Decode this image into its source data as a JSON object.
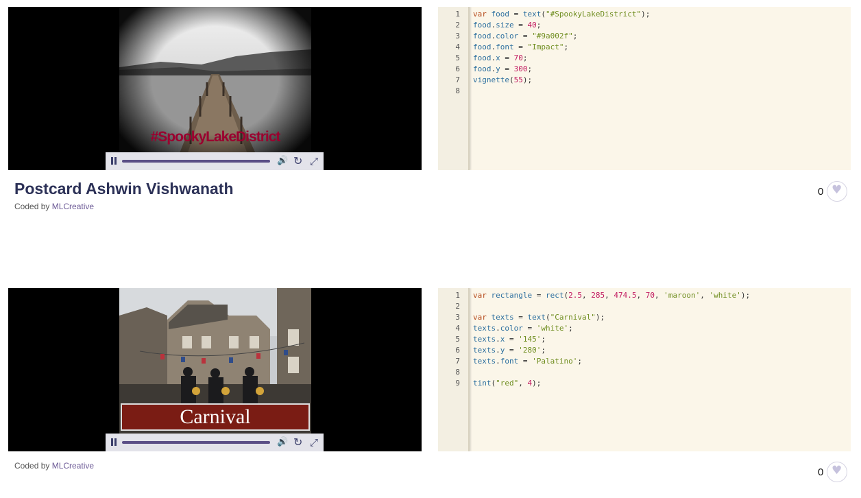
{
  "entries": [
    {
      "title": "Postcard Ashwin Vishwanath",
      "coded_by_prefix": "Coded by ",
      "author": "MLCreative",
      "likes": "0",
      "overlay_text": "#SpookyLakeDistrict",
      "code_lines": [
        "var food = text(\"#SpookyLakeDistrict\");",
        "food.size = 40;",
        "food.color = \"#9a002f\";",
        "food.font = \"Impact\";",
        "food.x = 70;",
        "food.y = 300;",
        "vignette(55);",
        ""
      ]
    },
    {
      "title": "",
      "coded_by_prefix": "Coded by ",
      "author": "MLCreative",
      "likes": "0",
      "overlay_text": "Carnival",
      "code_lines": [
        "var rectangle = rect(2.5, 285, 474.5, 70, 'maroon', 'white');",
        "",
        "var texts = text(\"Carnival\");",
        "texts.color = 'white';",
        "texts.x = '145';",
        "texts.y = '280';",
        "texts.font = 'Palatino';",
        "",
        "tint(\"red\", 4);"
      ]
    }
  ],
  "icons": {
    "pause": "pause-icon",
    "volume": "volume-icon",
    "replay": "replay-icon",
    "fullscreen": "fullscreen-icon",
    "like": "heart-icon"
  },
  "colors": {
    "title": "#2c3157",
    "author_link": "#6c5a96",
    "editor_bg": "#fbf6e9",
    "control_bar": "#e3e3ea"
  }
}
